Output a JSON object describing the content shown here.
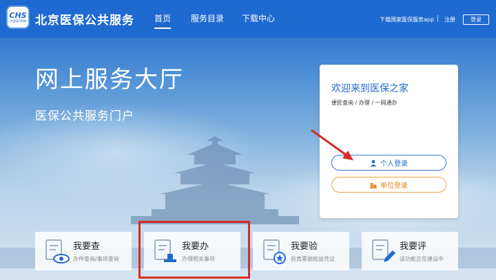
{
  "header": {
    "logo_text": "CHS",
    "logo_subtext": "中国医疗保障",
    "site_title": "北京医保公共服务",
    "nav": [
      {
        "label": "首页",
        "active": true
      },
      {
        "label": "服务目录",
        "active": false
      },
      {
        "label": "下载中心",
        "active": false
      }
    ],
    "app_link": "下载国家医保服务app",
    "register": "注册",
    "login": "登录"
  },
  "hero": {
    "title": "网上服务大厅",
    "subtitle": "医保公共服务门户"
  },
  "login_card": {
    "title": "欢迎来到医保之家",
    "subtitle": "便民查询 / 办理 / 一网通办",
    "personal_login": "个人登录",
    "unit_login": "单位登录"
  },
  "tiles": [
    {
      "name": "我要查",
      "desc": "办件查询/事项查询",
      "icon": "eye-document-icon"
    },
    {
      "name": "我要办",
      "desc": "办理相关事项",
      "icon": "stamp-document-icon"
    },
    {
      "name": "我要验",
      "desc": "验真票据权益凭证",
      "icon": "badge-document-icon"
    },
    {
      "name": "我要评",
      "desc": "该功能正在建设中",
      "icon": "pen-document-icon"
    }
  ],
  "colors": {
    "primary": "#1f6ad0",
    "accent_orange": "#f0a23c",
    "annotation_red": "#d62b25"
  }
}
